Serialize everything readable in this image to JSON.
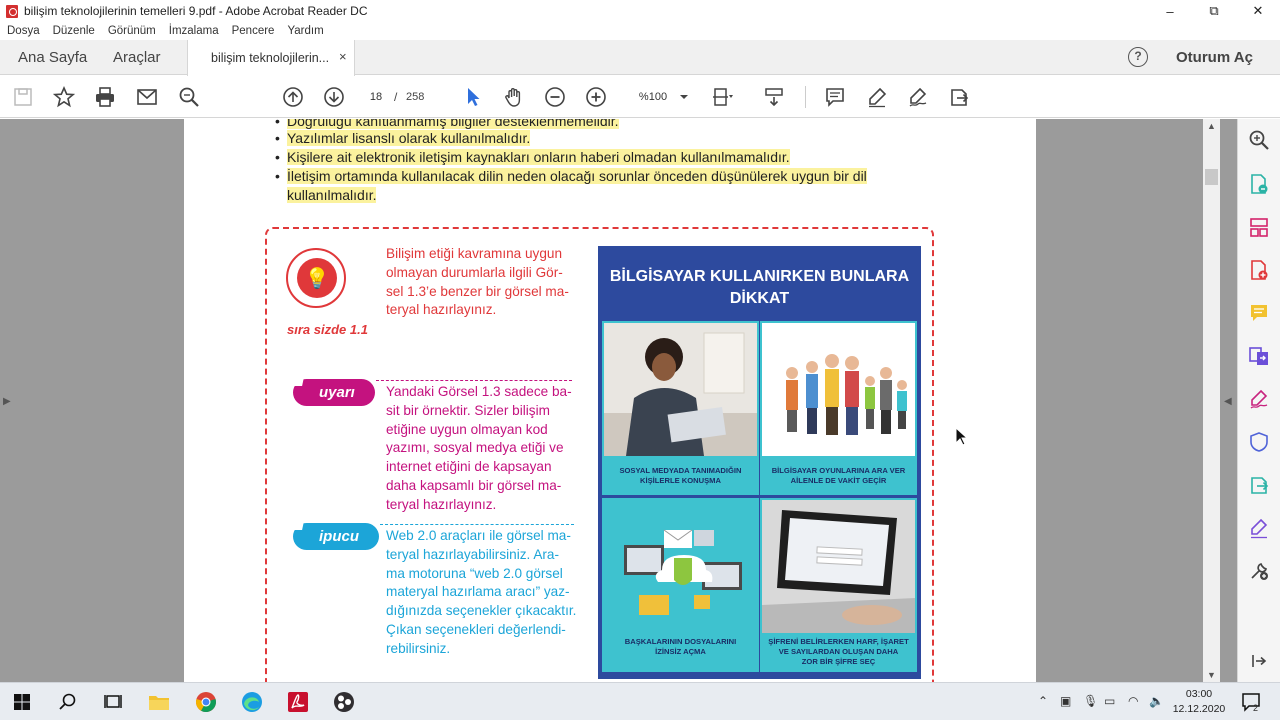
{
  "window": {
    "title": "bilişim teknolojilerinin temelleri 9.pdf - Adobe Acrobat Reader DC",
    "minimize": "–",
    "restore": "⧉",
    "close": "✕"
  },
  "menu": [
    "Dosya",
    "Düzenle",
    "Görünüm",
    "İmzalama",
    "Pencere",
    "Yardım"
  ],
  "tabs": {
    "home": "Ana Sayfa",
    "tools": "Araçlar",
    "document": "bilişim teknolojilerin...",
    "close": "×",
    "help": "?",
    "sign_in": "Oturum Aç"
  },
  "toolbar": {
    "page_current": "18",
    "page_separator": "/",
    "page_total": "258",
    "zoom": "%100"
  },
  "document": {
    "bullets": [
      "Doğruluğu kanıtlanmamış bilgiler desteklenmemelidir.",
      "Yazılımlar lisanslı olarak kullanılmalıdır.",
      "Kişilere ait elektronik iletişim kaynakları onların haberi olmadan kullanılmamalıdır.",
      "İletişim ortamında kullanılacak dilin neden olacağı sorunlar önceden düşünülerek uygun bir dil",
      "kullanılmalıdır."
    ],
    "sira_label": "sıra sizde 1.1",
    "sira_lines": [
      "Bilişim etiği kavramına uygun",
      "olmayan durumlarla ilgili Gör-",
      "sel 1.3’e benzer bir görsel ma-",
      "teryal hazırlayınız."
    ],
    "uyari_label": "uyarı",
    "uyari_lines": [
      "Yandaki Görsel 1.3 sadece ba-",
      "sit bir örnektir. Sizler bilişim",
      "etiğine uygun olmayan kod",
      "yazımı, sosyal medya etiği ve",
      "internet etiğini de kapsayan",
      "daha kapsamlı bir görsel ma-",
      "teryal hazırlayınız."
    ],
    "ipucu_label": "ipucu",
    "ipucu_lines": [
      "Web 2.0 araçları ile görsel ma-",
      "teryal hazırlayabilirsiniz. Ara-",
      "ma motoruna “web 2.0 görsel",
      "materyal hazırlama aracı” yaz-",
      "dığınızda seçenekler çıkacaktır.",
      "Çıkan seçenekleri değerlendi-",
      "rebilirsiniz."
    ],
    "poster": {
      "title_line1": "BİLGİSAYAR KULLANIRKEN BUNLARA",
      "title_line2": "DİKKAT",
      "captions": [
        [
          "SOSYAL MEDYADA TANIMADIĞIN",
          "KİŞİLERLE KONUŞMA"
        ],
        [
          "BİLGİSAYAR OYUNLARINA ARA VER",
          "AİLENLE DE VAKİT GEÇİR"
        ],
        [
          "BAŞKALARININ DOSYALARINI",
          "İZİNSİZ AÇMA"
        ],
        [
          "ŞİFRENİ BELİRLERKEN HARF, İŞARET",
          "VE SAYILARDAN OLUŞAN DAHA",
          "ZOR BİR ŞİFRE SEÇ"
        ]
      ]
    }
  },
  "taskbar": {
    "time": "03:00",
    "date": "12.12.2020",
    "notification_count": "2"
  },
  "colors": {
    "acrobat_red": "#d32f2f",
    "highlight": "#fbf29e",
    "sira_red": "#e0383a",
    "uyari_magenta": "#c4127f",
    "ipucu_cyan": "#1ca5d8",
    "poster_blue": "#2d4a9e",
    "poster_teal": "#3ec2cf"
  }
}
